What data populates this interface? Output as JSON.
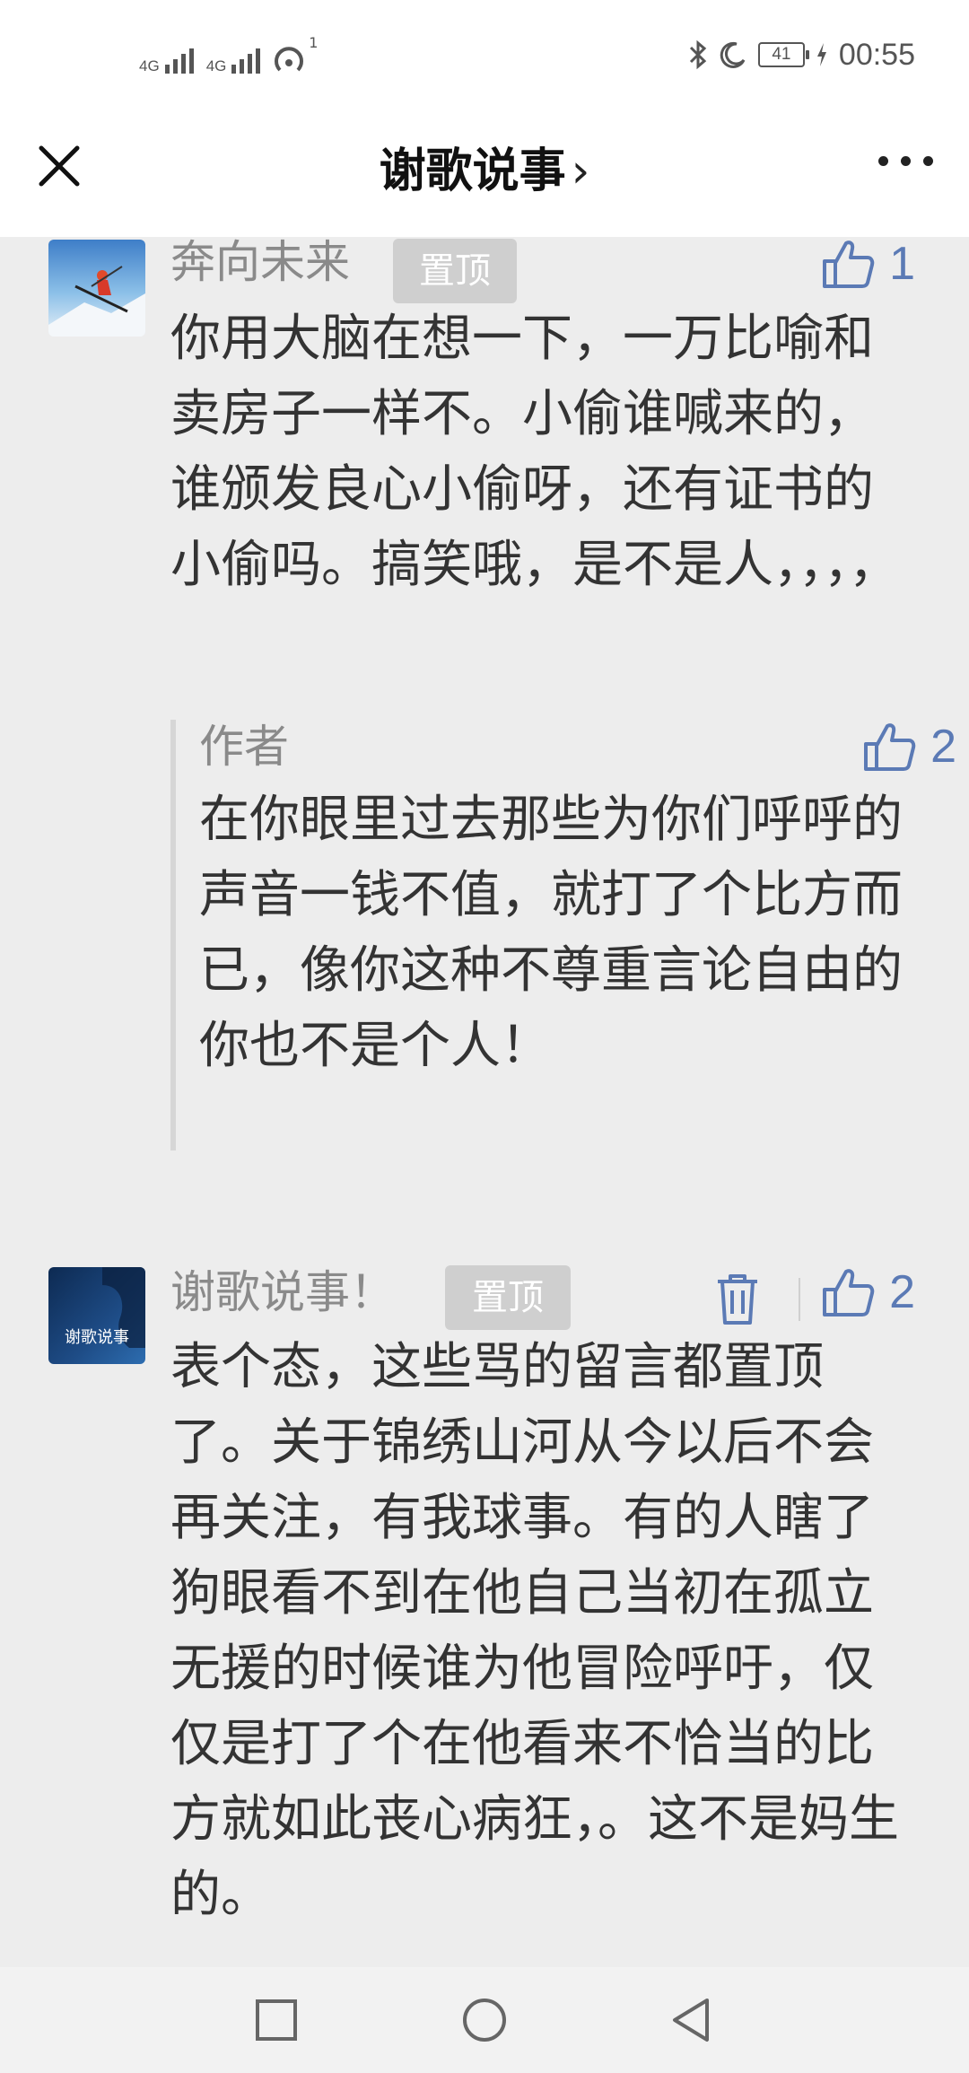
{
  "status_bar": {
    "network_1": "4G",
    "network_2": "4G",
    "hotspot_count": "1",
    "battery": "41",
    "time": "00:55",
    "icons": [
      "bluetooth-icon",
      "moon-icon",
      "battery-icon",
      "charging-icon"
    ]
  },
  "header": {
    "title": "谢歌说事",
    "chevron": "›",
    "close_icon": "close-icon",
    "more_icon": "more-dots-icon"
  },
  "comments": [
    {
      "author": "奔向未来",
      "pinned_label": "置顶",
      "likes": "1",
      "text": "你用大脑在想一下，一万比喻和卖房子一样不。小偷谁喊来的，谁颁发良心小偷呀，还有证书的小偷吗。搞笑哦，是不是人，，，，",
      "reply": {
        "author": "作者",
        "likes": "2",
        "text": "在你眼里过去那些为你们呼呼的声音一钱不值，就打了个比方而已，像你这种不尊重言论自由的你也不是个人！"
      }
    },
    {
      "author": "谢歌说事！",
      "pinned_label": "置顶",
      "likes": "2",
      "avatar_text": "谢歌说事",
      "text": "表个态，这些骂的留言都置顶了。关于锦绣山河从今以后不会再关注，有我球事。有的人瞎了狗眼看不到在他自己当初在孤立无援的时候谁为他冒险呼吁，仅仅是打了个在他看来不恰当的比方就如此丧心病狂，。这不是妈生的。"
    }
  ],
  "colors": {
    "background": "#ededed",
    "like_blue": "#5b7ab5",
    "name_gray": "#8a8a8a",
    "pin_bg": "#cfcfcf"
  },
  "navbar": {
    "icons": [
      "recent-apps-icon",
      "home-icon",
      "back-icon"
    ]
  }
}
